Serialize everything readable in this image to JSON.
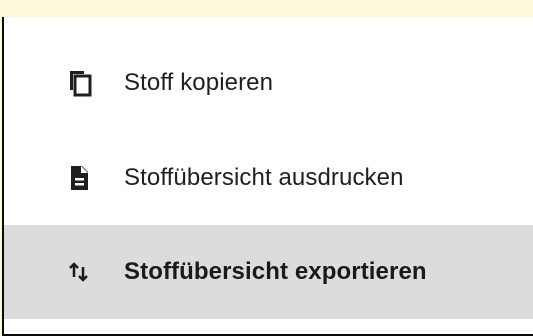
{
  "menu": {
    "items": [
      {
        "label": "Stoff kopieren",
        "icon": "copy-icon"
      },
      {
        "label": "Stoffübersicht ausdrucken",
        "icon": "document-icon"
      },
      {
        "label": "Stoffübersicht exportieren",
        "icon": "export-arrows-icon",
        "highlighted": true
      }
    ]
  },
  "colors": {
    "background_strip": "#fdf8dc",
    "highlight": "#dcdcdc",
    "text": "#1f1f1f"
  }
}
